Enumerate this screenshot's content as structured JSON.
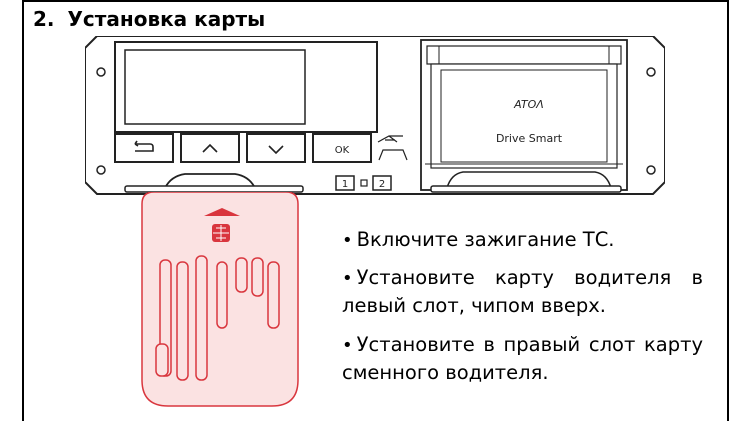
{
  "section": {
    "number": "2.",
    "title": "Установка карты"
  },
  "device": {
    "brand": "ATOΛ",
    "model": "Drive Smart",
    "buttons": {
      "back_icon": "back-arrow-icon",
      "up_icon": "chevron-up-icon",
      "down_icon": "chevron-down-icon",
      "ok_label": "OK",
      "usb_icon": "usb-icon"
    },
    "slot_labels": {
      "slot1": "1",
      "slot2": "2"
    }
  },
  "instructions": [
    {
      "text": "Включите зажигание ТС."
    },
    {
      "text": "Установите карту водителя в левый слот, чипом вверх."
    },
    {
      "text": "Установите в правый слот карту сменного водителя."
    }
  ],
  "colors": {
    "card_accent": "#d9363e",
    "card_fill": "#fbe2e2"
  }
}
